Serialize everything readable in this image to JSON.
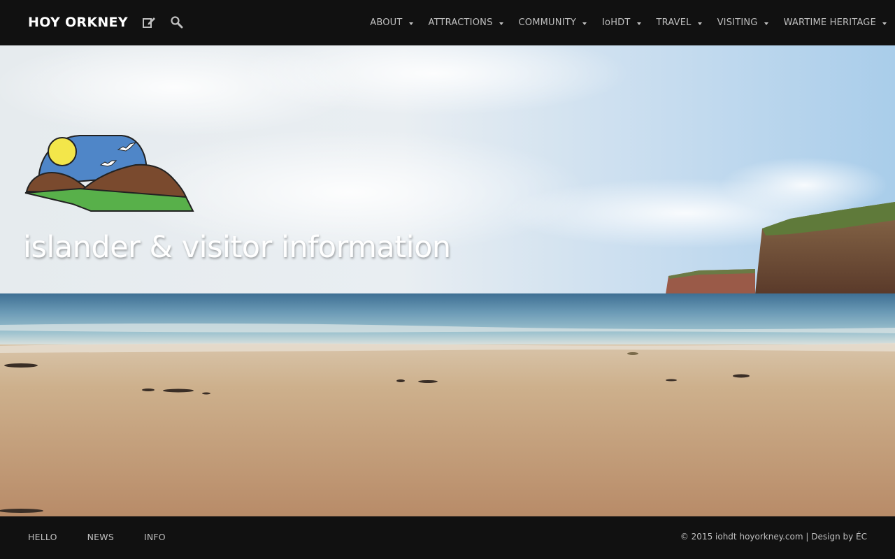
{
  "header": {
    "site_title": "HOY ORKNEY",
    "icons": [
      "write-icon",
      "search-icon"
    ],
    "nav": [
      {
        "label": "ABOUT"
      },
      {
        "label": "ATTRACTIONS"
      },
      {
        "label": "COMMUNITY"
      },
      {
        "label": "IoHDT"
      },
      {
        "label": "TRAVEL"
      },
      {
        "label": "VISITING"
      },
      {
        "label": "WARTIME HERITAGE"
      }
    ]
  },
  "hero": {
    "tagline": "islander & visitor information"
  },
  "footer": {
    "links": [
      {
        "label": "HELLO"
      },
      {
        "label": "NEWS"
      },
      {
        "label": "INFO"
      }
    ],
    "copyright": "© 2015 iohdt",
    "site_link": "hoyorkney.com",
    "separator": " | ",
    "design": "Design by ÉC"
  },
  "colors": {
    "bar_background": "#111111",
    "nav_text": "#bfbfbf",
    "title_text": "#ffffff"
  }
}
